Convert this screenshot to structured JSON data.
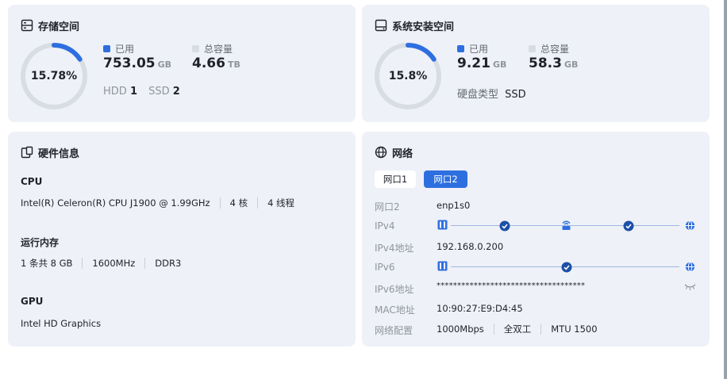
{
  "storage": {
    "title": "存储空间",
    "percent_text": "15.78%",
    "percent": 15.78,
    "used_label": "已用",
    "used_value": "753.05",
    "used_unit": "GB",
    "total_label": "总容量",
    "total_value": "4.66",
    "total_unit": "TB",
    "hdd_label": "HDD",
    "hdd_count": "1",
    "ssd_label": "SSD",
    "ssd_count": "2"
  },
  "system_storage": {
    "title": "系统安装空间",
    "percent_text": "15.8%",
    "percent": 15.8,
    "used_label": "已用",
    "used_value": "9.21",
    "used_unit": "GB",
    "total_label": "总容量",
    "total_value": "58.3",
    "total_unit": "GB",
    "disk_type_label": "硬盘类型",
    "disk_type_value": "SSD"
  },
  "hardware": {
    "title": "硬件信息",
    "cpu_heading": "CPU",
    "cpu_model": "Intel(R) Celeron(R) CPU J1900 @ 1.99GHz",
    "cpu_cores": "4 核",
    "cpu_threads": "4 线程",
    "memory_heading": "运行内存",
    "memory_modules": "1 条共 8 GB",
    "memory_speed": "1600MHz",
    "memory_type": "DDR3",
    "gpu_heading": "GPU",
    "gpu_model": "Intel HD Graphics"
  },
  "network": {
    "title": "网络",
    "tabs": [
      "网口1",
      "网口2"
    ],
    "active_tab": "网口2",
    "rows": {
      "port_label": "网口2",
      "port_value": "enp1s0",
      "ipv4_label": "IPv4",
      "ipv4_addr_label": "IPv4地址",
      "ipv4_addr_value": "192.168.0.200",
      "ipv6_label": "IPv6",
      "ipv6_addr_label": "IPv6地址",
      "ipv6_addr_value": "************************************",
      "mac_label": "MAC地址",
      "mac_value": "10:90:27:E9:D4:45",
      "config_label": "网络配置",
      "config_speed": "1000Mbps",
      "config_duplex": "全双工",
      "config_mtu": "MTU 1500"
    }
  },
  "colors": {
    "accent": "#2e6fe0",
    "ring_bg": "#d8dce3",
    "card_bg": "#eef1f7"
  },
  "icons": [
    "storage-icon",
    "system-disk-icon",
    "hardware-icon",
    "globe-icon",
    "nic-icon",
    "check-icon",
    "router-icon",
    "eye-off-icon"
  ]
}
